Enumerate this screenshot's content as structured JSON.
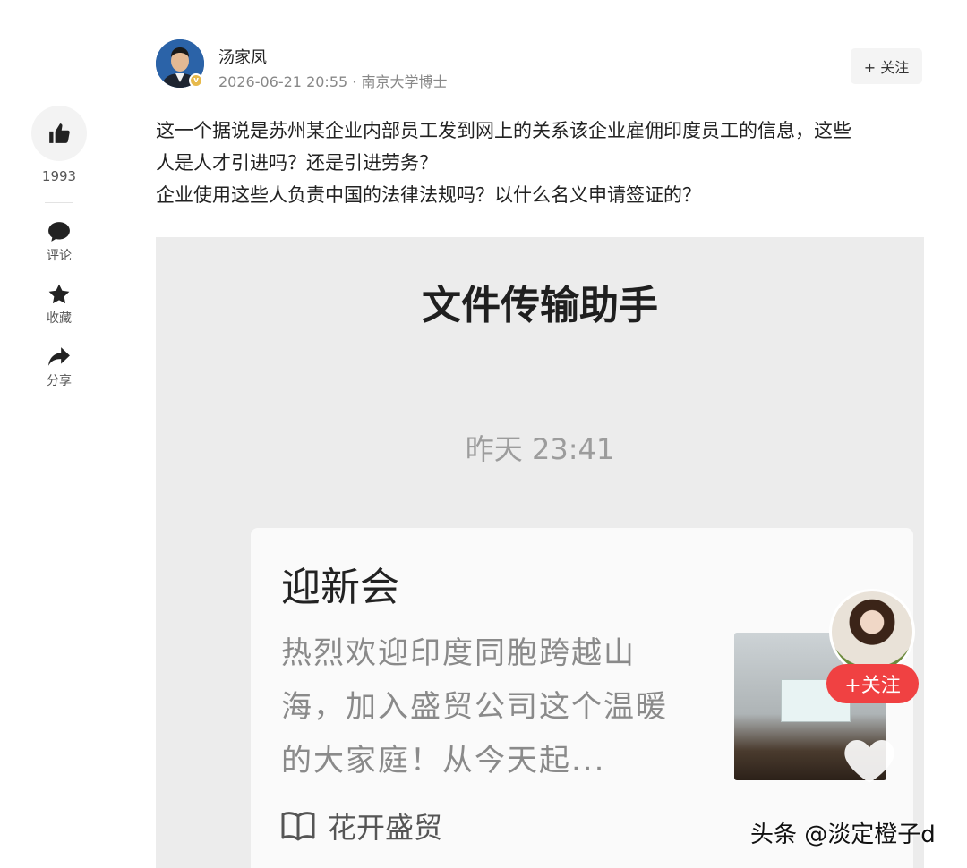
{
  "header": {
    "author": "汤家凤",
    "date": "2026-06-21 20:55",
    "separator": "·",
    "affiliation": "南京大学博士",
    "follow_label": "+ 关注"
  },
  "rail": {
    "like_count": "1993",
    "comment_label": "评论",
    "favorite_label": "收藏",
    "share_label": "分享"
  },
  "post": {
    "line1": "这一个据说是苏州某企业内部员工发到网上的关系该企业雇佣印度员工的信息，这些",
    "line2": "人是人才引进吗？还是引进劳务？",
    "line3": "企业使用这些人负责中国的法律法规吗？以什么名义申请签证的？"
  },
  "embedded": {
    "chat_title": "文件传输助手",
    "chat_time": "昨天 23:41",
    "card_title": "迎新会",
    "card_desc": "热烈欢迎印度同胞跨越山海，加入盛贸公司这个温暖的大家庭！从今天起...",
    "card_source": "花开盛贸"
  },
  "floating": {
    "follow_label": "+关注"
  },
  "watermark": "头条 @淡定橙子d"
}
